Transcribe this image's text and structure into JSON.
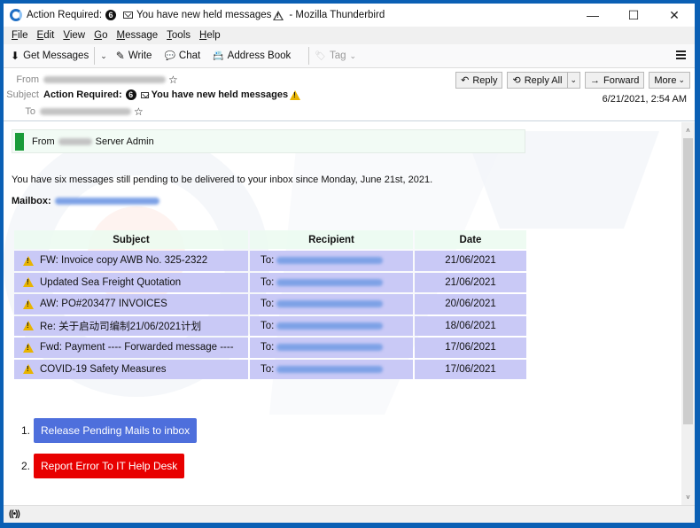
{
  "window": {
    "title_prefix": "Action Required:",
    "title_badge": "6",
    "title_middle": "You have new held messages",
    "title_suffix": "- Mozilla Thunderbird",
    "controls": {
      "minimize": "—",
      "maximize": "☐",
      "close": "✕"
    }
  },
  "menubar": {
    "items": [
      {
        "u": "F",
        "rest": "ile"
      },
      {
        "u": "E",
        "rest": "dit"
      },
      {
        "u": "V",
        "rest": "iew"
      },
      {
        "u": "G",
        "rest": "o"
      },
      {
        "u": "M",
        "rest": "essage"
      },
      {
        "u": "T",
        "rest": "ools"
      },
      {
        "u": "H",
        "rest": "elp"
      }
    ]
  },
  "toolbar": {
    "get_messages": "Get Messages",
    "write": "Write",
    "chat": "Chat",
    "address_book": "Address Book",
    "tag": "Tag",
    "icons": {
      "get_messages": "⬇",
      "write": "✎",
      "chat": "💬",
      "address_book": "📇",
      "tag": "🏷"
    }
  },
  "header": {
    "from_label": "From",
    "subject_label": "Subject",
    "to_label": "To",
    "subject_prefix": "Action Required:",
    "subject_badge": "6",
    "subject_text": "You have new held messages",
    "date": "6/21/2021, 2:54 AM",
    "buttons": {
      "reply": "Reply",
      "reply_all": "Reply All",
      "forward": "Forward",
      "more": "More"
    },
    "icons": {
      "reply": "↶",
      "reply_all": "⟲",
      "forward": "→",
      "dropdown": "⌄",
      "star": "☆"
    }
  },
  "message": {
    "from_word": "From",
    "from_name": "Server Admin",
    "intro": "You have six messages still pending to be delivered to your inbox since Monday, June 21st, 2021.",
    "mailbox_label": "Mailbox:",
    "table": {
      "headers": [
        "Subject",
        "Recipient",
        "Date"
      ],
      "rows": [
        {
          "subject": "FW: Invoice copy AWB No. 325-2322",
          "to": "To:",
          "date": "21/06/2021"
        },
        {
          "subject": "Updated Sea Freight Quotation",
          "to": "To:",
          "date": "21/06/2021"
        },
        {
          "subject": "AW: PO#203477 INVOICES",
          "to": "To:",
          "date": "20/06/2021"
        },
        {
          "subject": "Re: 关于启动司编制21/06/2021计划",
          "to": "To:",
          "date": "18/06/2021"
        },
        {
          "subject": "Fwd: Payment ---- Forwarded message ----",
          "to": "To:",
          "date": "17/06/2021"
        },
        {
          "subject": "COVID-19 Safety Measures",
          "to": "To:",
          "date": "17/06/2021"
        }
      ]
    },
    "actions": [
      {
        "num": "1.",
        "label": "Release Pending Mails to inbox",
        "color": "#4e6fdc"
      },
      {
        "num": "2.",
        "label": "Report Error To IT Help Desk",
        "color": "#e80000"
      }
    ]
  },
  "scrollbar": {
    "up": "˄",
    "down": "˅"
  },
  "statusbar": {
    "icon": "((•))"
  },
  "colors": {
    "accent_blue": "#0a5fb4",
    "from_bar_green": "#1a9b39",
    "table_row": "#c9c9f6"
  }
}
